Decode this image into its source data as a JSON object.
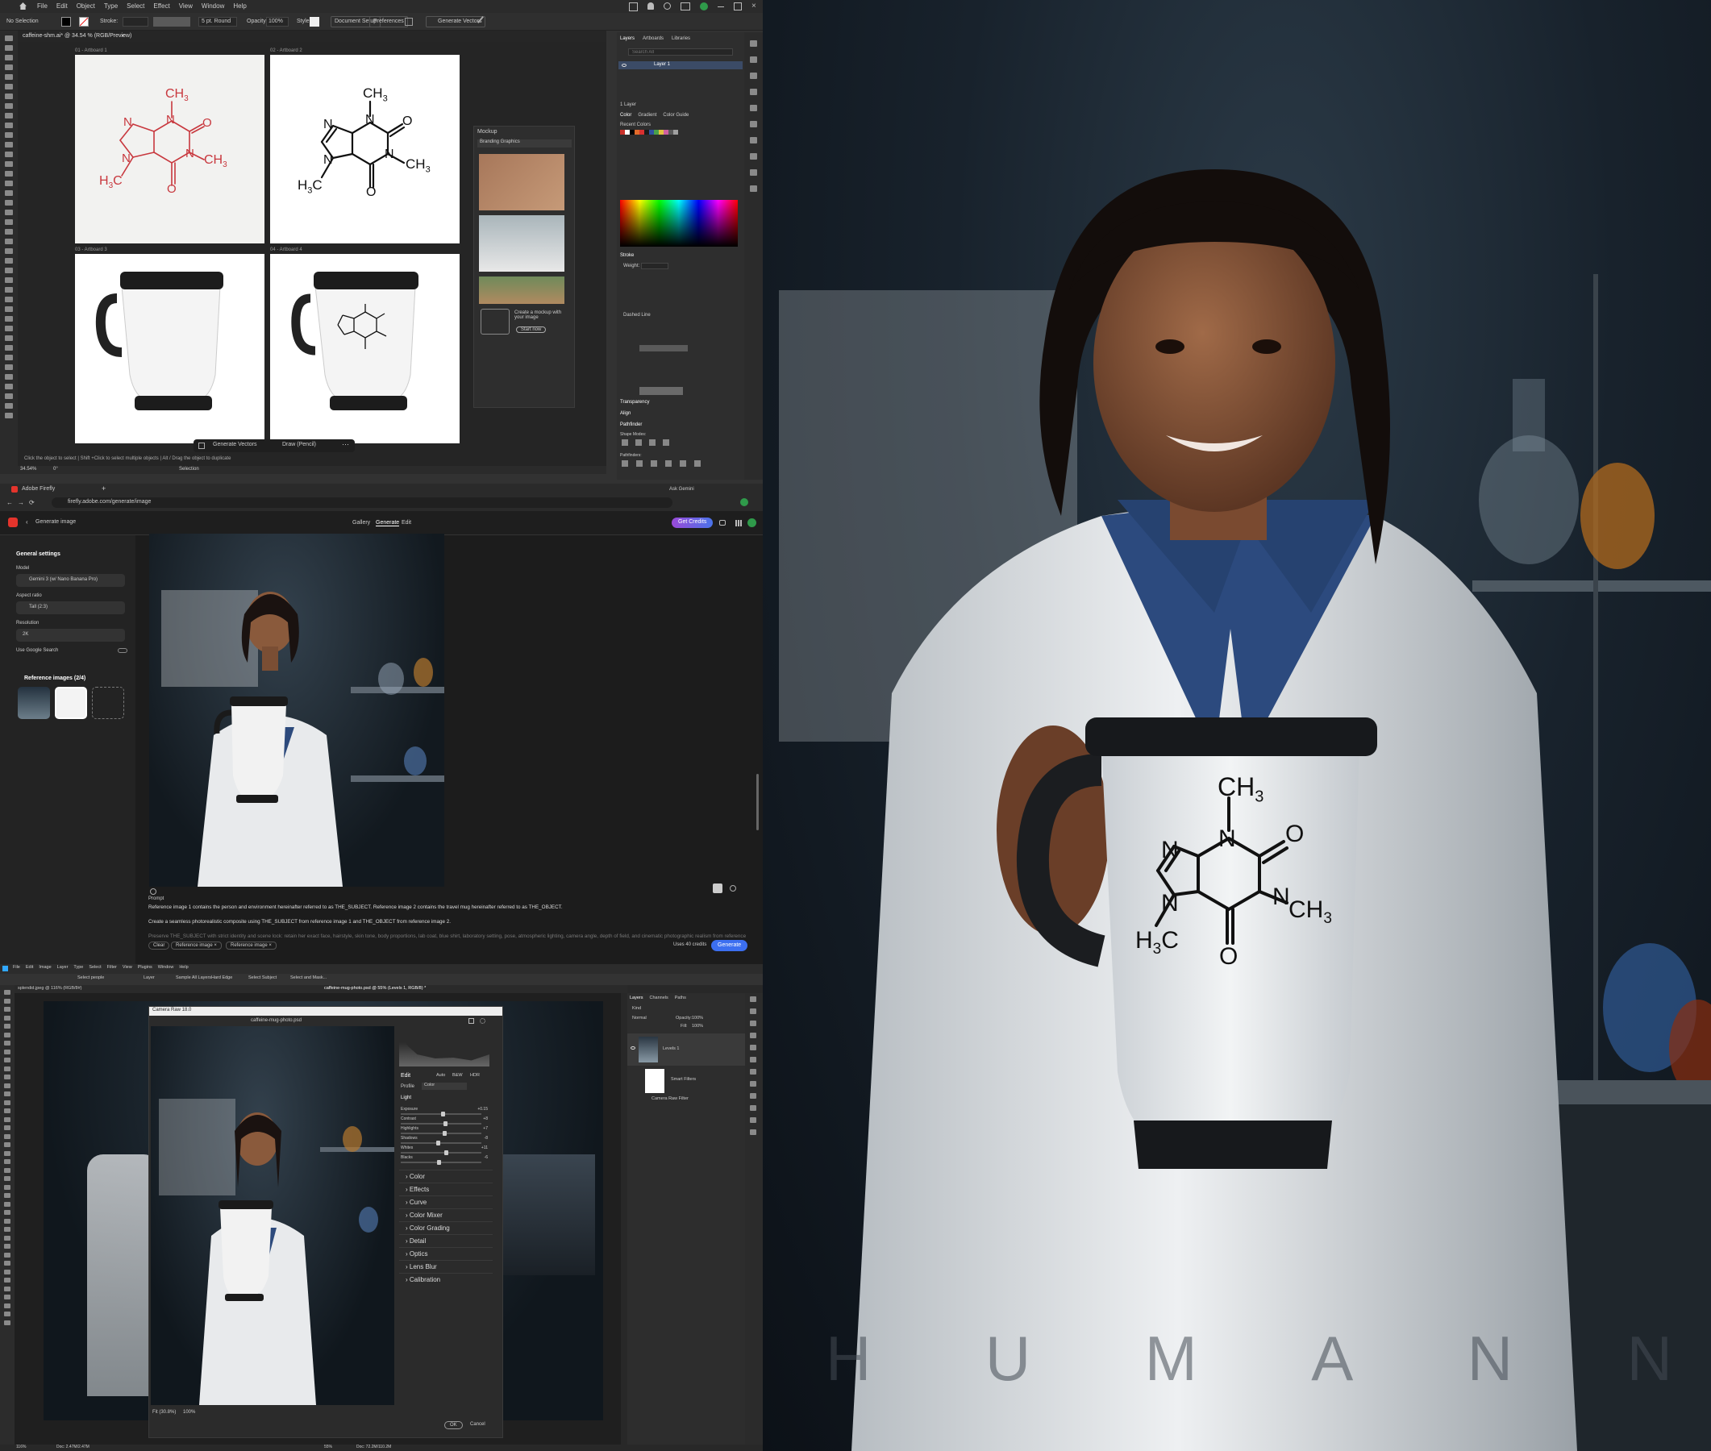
{
  "illustrator": {
    "menu": [
      "File",
      "Edit",
      "Object",
      "Type",
      "Select",
      "Effect",
      "View",
      "Window",
      "Help"
    ],
    "control": {
      "selection": "No Selection",
      "stroke_label": "Stroke:",
      "brush": "5 pt. Round",
      "opacity_label": "Opacity:",
      "opacity_value": "100%",
      "style_label": "Style:",
      "document_setup": "Document Setup",
      "preferences": "Preferences",
      "generate_vectors": "Generate Vectors"
    },
    "doc_tab": "caffeine-shm.ai* @ 34.54 % (RGB/Preview)",
    "artboards": [
      "01 - Artboard 1",
      "02 - Artboard 2",
      "03 - Artboard 3",
      "04 - Artboard 4"
    ],
    "bottom_bar": {
      "generate_vectors": "Generate Vectors",
      "draw": "Draw (Pencil)"
    },
    "status": {
      "zoom": "34.54%",
      "angle": "0°",
      "hint": "Click the object to select | Shift +Click to select multiple objects | Alt / Drag the object to duplicate",
      "mode": "Selection"
    },
    "mockup": {
      "title": "Mockup",
      "category": "Branding Graphics",
      "promo": "Create a mockup with your image",
      "start": "Start now"
    },
    "panels": {
      "layers_tabs": [
        "Layers",
        "Artboards",
        "Libraries"
      ],
      "search_placeholder": "Search All",
      "layer_name": "Layer 1",
      "layers_count": "1 Layer",
      "color_tabs": [
        "Color",
        "Gradient",
        "Color Guide"
      ],
      "recent_colors": "Recent Colors",
      "stroke": "Stroke",
      "weight_label": "Weight:",
      "dashed_line": "Dashed Line",
      "transparency": "Transparency",
      "align": "Align",
      "pathfinder": "Pathfinder",
      "shape_modes": "Shape Modes:",
      "pathfinders": "Pathfinders:"
    },
    "molecule": {
      "ch3_top": "CH",
      "ch3_right": "CH",
      "h3c": "H",
      "c": "C",
      "sub3": "3",
      "n": "N",
      "o": "O"
    }
  },
  "firefly": {
    "browser_tab": "Adobe Firefly",
    "url": "firefly.adobe.com/generate/image",
    "ask_gemini": "Ask Gemini",
    "header": {
      "back_title": "Generate image",
      "nav": [
        "Gallery",
        "Generate",
        "Edit"
      ],
      "get_credits": "Get Credits"
    },
    "sidebar": {
      "general_settings": "General settings",
      "model_label": "Model",
      "model_value": "Gemini 3 (w/ Nano Banana Pro)",
      "aspect_label": "Aspect ratio",
      "aspect_value": "Tall (2:3)",
      "resolution_label": "Resolution",
      "resolution_value": "2K",
      "google_search": "Use Google Search",
      "reference_images": "Reference images (2/4)"
    },
    "prompt": {
      "label": "Prompt",
      "line1": "Reference image 1 contains the person and environment hereinafter referred to as THE_SUBJECT. Reference image 2 contains the travel mug hereinafter referred to as THE_OBJECT.",
      "line2": "Create a seamless photorealistic composite using THE_SUBJECT from reference image 1 and THE_OBJECT from reference image 2.",
      "line3": "Preserve THE_SUBJECT with strict identity and scene lock: retain her exact face, hairstyle, skin tone, body proportions, lab coat, blue shirt, laboratory setting, pose, atmospheric lighting, camera angle, depth of field, and cinematic photographic realism from reference"
    },
    "footer": {
      "clear": "Clear",
      "chip1": "Reference image",
      "chip2": "Reference image",
      "credits": "Uses 40 credits",
      "generate": "Generate"
    }
  },
  "photoshop": {
    "menu": [
      "File",
      "Edit",
      "Image",
      "Layer",
      "Type",
      "Select",
      "Filter",
      "View",
      "Plugins",
      "Window",
      "Help"
    ],
    "options": {
      "select_people": "Select people",
      "layer": "Layer",
      "sample_all": "Sample All Layers",
      "hard_edge": "Hard Edge",
      "select_subject": "Select Subject",
      "select_mask": "Select and Mask..."
    },
    "tabs": [
      "splendid.jpeg @ 116% (RGB/8#)",
      "caffeine-mug-photo.psd @ 55% (Levels 1, RGB/8) *"
    ],
    "camera_raw": {
      "title": "Camera Raw 18.0",
      "file": "caffeine-mug-photo.psd",
      "edit": "Edit",
      "auto": "Auto",
      "bw": "B&W",
      "hdr": "HDR",
      "profile_label": "Profile",
      "profile_value": "Color",
      "light": "Light",
      "sliders": [
        {
          "label": "Exposure",
          "value": "+0.15",
          "pos": 0.52
        },
        {
          "label": "Contrast",
          "value": "+8",
          "pos": 0.55
        },
        {
          "label": "Highlights",
          "value": "+7",
          "pos": 0.54
        },
        {
          "label": "Shadows",
          "value": "-8",
          "pos": 0.46
        },
        {
          "label": "Whites",
          "value": "+11",
          "pos": 0.56
        },
        {
          "label": "Blacks",
          "value": "-6",
          "pos": 0.47
        }
      ],
      "sections": [
        "Color",
        "Effects",
        "Curve",
        "Color Mixer",
        "Color Grading",
        "Detail",
        "Optics",
        "Lens Blur",
        "Calibration"
      ],
      "zoom_fit": "Fit (30.8%)",
      "zoom_100": "100%",
      "ok": "OK",
      "cancel": "Cancel"
    },
    "layers": {
      "tabs": [
        "Layers",
        "Channels",
        "Paths"
      ],
      "kind": "Kind",
      "blend": "Normal",
      "opacity_label": "Opacity:",
      "opacity": "100%",
      "fill_label": "Fill:",
      "fill": "100%",
      "layer_name": "Levels 1",
      "smart_filters": "Smart Filters",
      "camera_raw_filter": "Camera Raw Filter"
    },
    "status": {
      "zoom": "116%",
      "doc": "Doc: 2.47M/2.47M",
      "zoom2": "55%",
      "doc2": "Doc: 72.2M/110.2M"
    }
  },
  "hero": {
    "wordmark": [
      "H",
      "U",
      "M",
      "A",
      "N",
      "N"
    ],
    "mug": {
      "ch": "CH",
      "h": "H",
      "c": "C",
      "sub3": "3",
      "n": "N",
      "o": "O"
    }
  },
  "colors": {
    "firefly_red": "#e4342c",
    "firefly_blue": "#3c6ff0",
    "credits_gradient": "#9b4ad9",
    "accent_blue": "#2e74da",
    "molecule_red": "#c8383e",
    "swatches": [
      "#c8312a",
      "#ffffff",
      "#000000",
      "#e06a2a",
      "#d83030",
      "#1a1a1a",
      "#3050a0",
      "#4aa04a",
      "#e0c040",
      "#d060a0",
      "#5a5a5a",
      "#a0a0a0"
    ]
  }
}
